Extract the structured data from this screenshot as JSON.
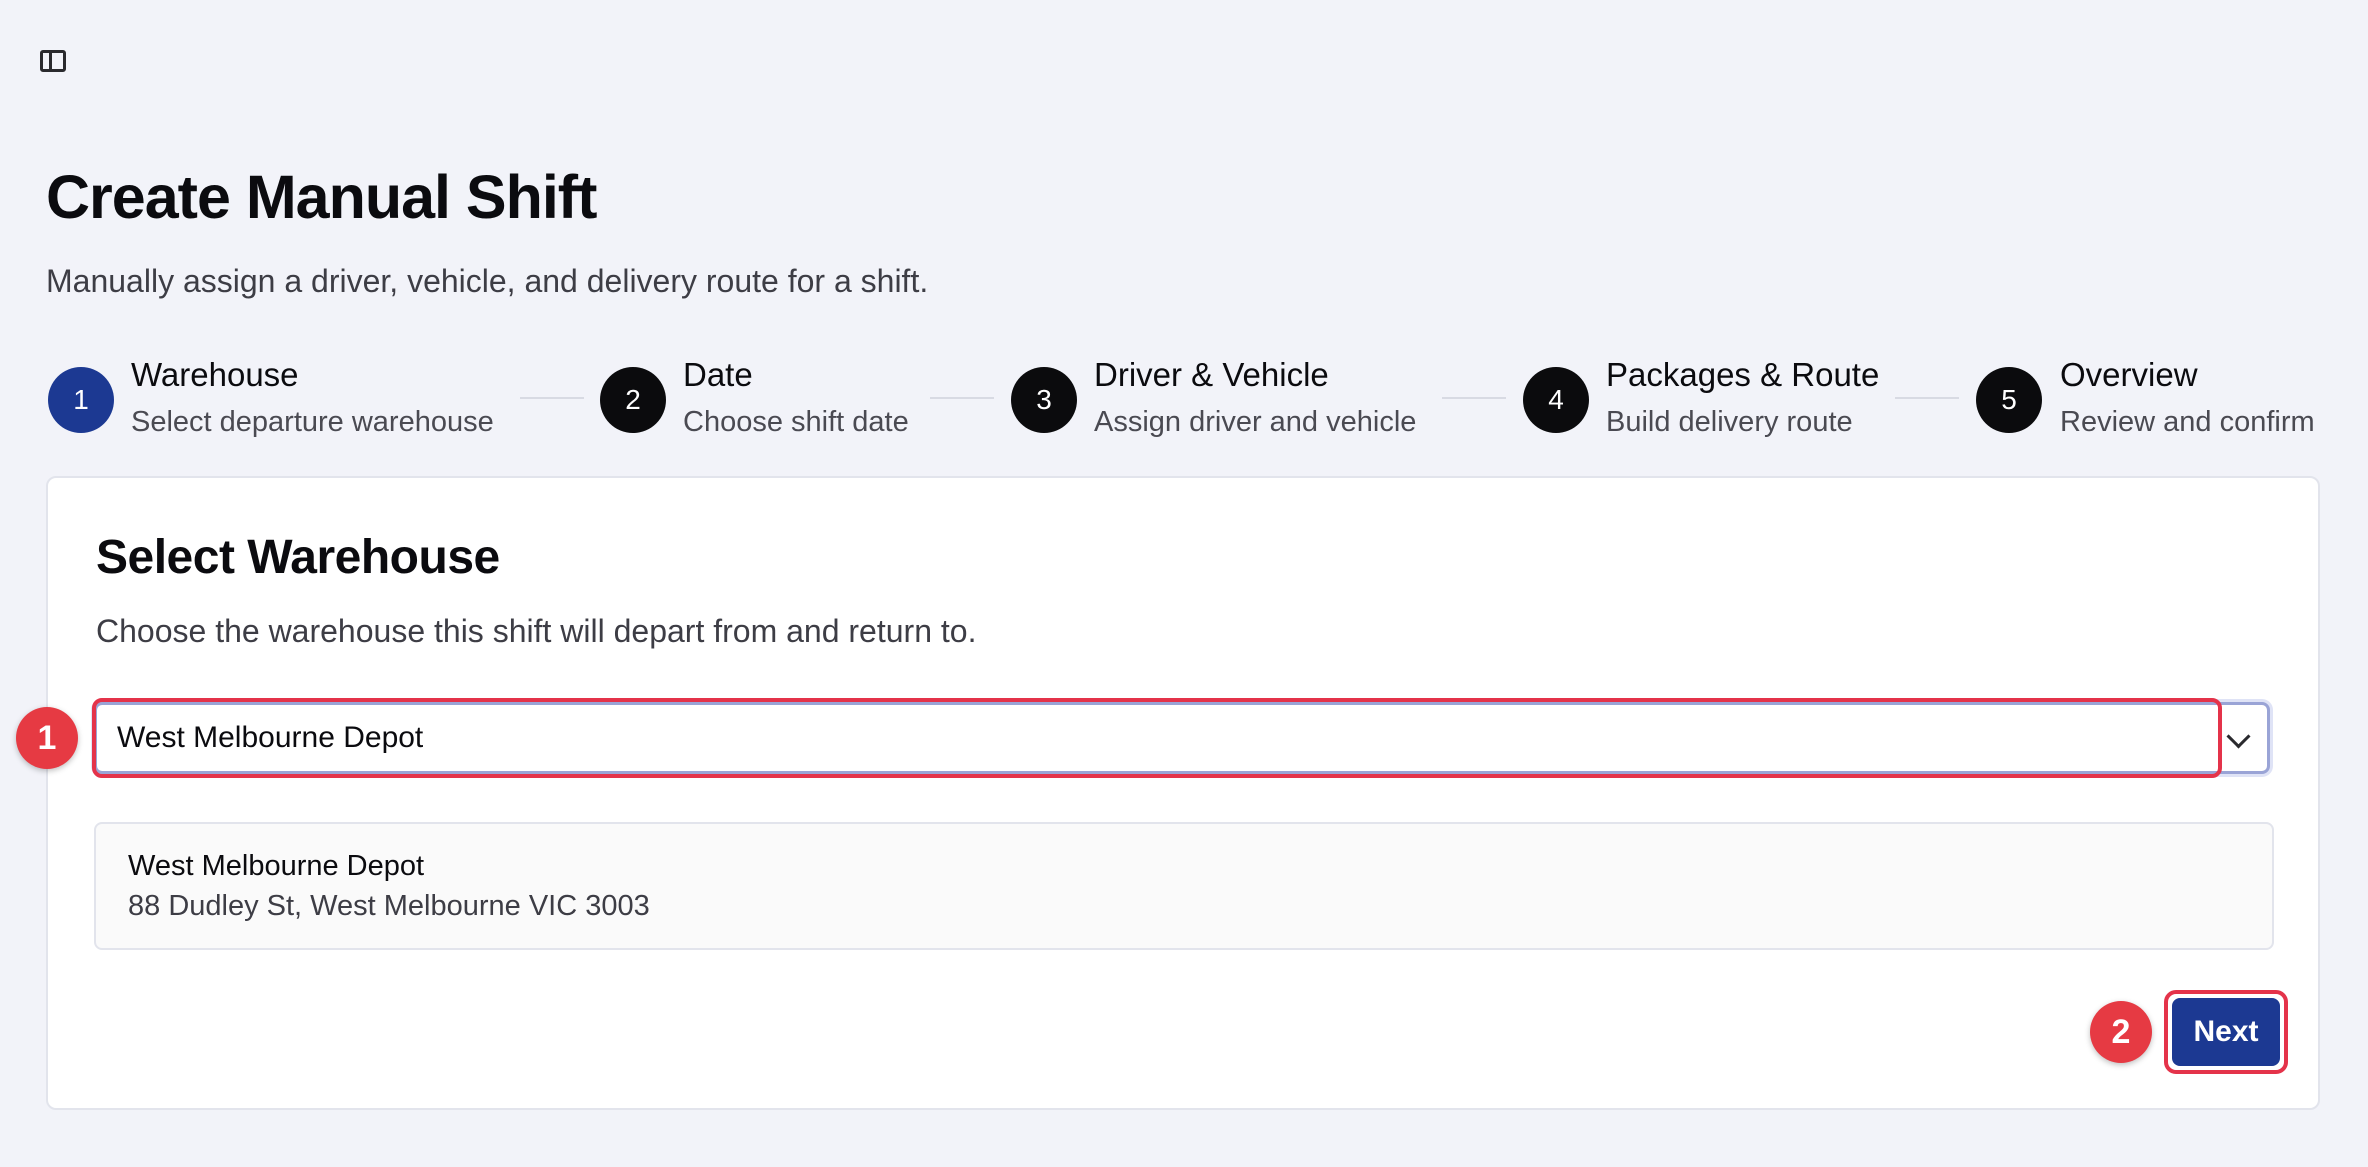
{
  "header": {
    "title": "Create Manual Shift",
    "subtitle": "Manually assign a driver, vehicle, and delivery route for a shift."
  },
  "stepper": {
    "steps": [
      {
        "number": "1",
        "title": "Warehouse",
        "description": "Select departure warehouse",
        "active": true
      },
      {
        "number": "2",
        "title": "Date",
        "description": "Choose shift date",
        "active": false
      },
      {
        "number": "3",
        "title": "Driver & Vehicle",
        "description": "Assign driver and vehicle",
        "active": false
      },
      {
        "number": "4",
        "title": "Packages & Route",
        "description": "Build delivery route",
        "active": false
      },
      {
        "number": "5",
        "title": "Overview",
        "description": "Review and confirm",
        "active": false
      }
    ]
  },
  "card": {
    "title": "Select Warehouse",
    "description": "Choose the warehouse this shift will depart from and return to.",
    "select": {
      "value": "West Melbourne Depot"
    },
    "warehouse": {
      "name": "West Melbourne Depot",
      "address": "88 Dudley St, West Melbourne VIC 3003"
    },
    "next_label": "Next"
  },
  "annotations": {
    "select_marker": "1",
    "next_marker": "2"
  },
  "colors": {
    "accent": "#1c3992",
    "highlight": "#e4334a"
  }
}
